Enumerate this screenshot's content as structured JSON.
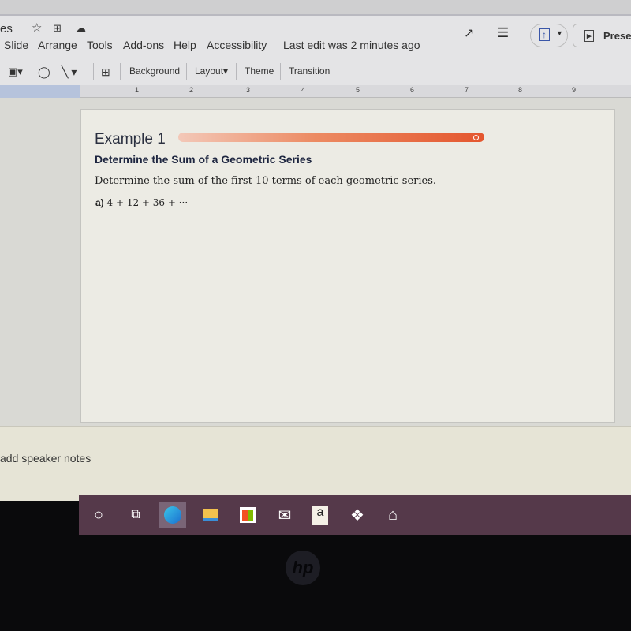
{
  "header": {
    "title": "es",
    "last_edit": "Last edit was 2 minutes ago",
    "present_label": "Presen"
  },
  "menus": [
    "Slide",
    "Arrange",
    "Tools",
    "Add-ons",
    "Help",
    "Accessibility"
  ],
  "toolbar": {
    "background": "Background",
    "layout": "Layout▾",
    "theme": "Theme",
    "transition": "Transition"
  },
  "ruler": [
    "1",
    "2",
    "3",
    "4",
    "5",
    "6",
    "7",
    "8",
    "9"
  ],
  "slide": {
    "heading": "Example 1",
    "subheading": "Determine the Sum of a Geometric Series",
    "instruction": "Determine the sum of the first 10 terms of each geometric series.",
    "part_label": "a)",
    "part_expr": "4 + 12 + 36 + ···",
    "accent_color": "#e4562e"
  },
  "notes": {
    "placeholder": "add speaker notes"
  },
  "taskbar": {
    "icons": [
      "cortana-icon",
      "task-view-icon",
      "edge-icon",
      "file-explorer-icon",
      "store-icon",
      "mail-icon",
      "amazon-icon",
      "dropbox-icon",
      "app-icon"
    ],
    "amazon_glyph": "a"
  },
  "bezel": {
    "logo": "hp"
  }
}
